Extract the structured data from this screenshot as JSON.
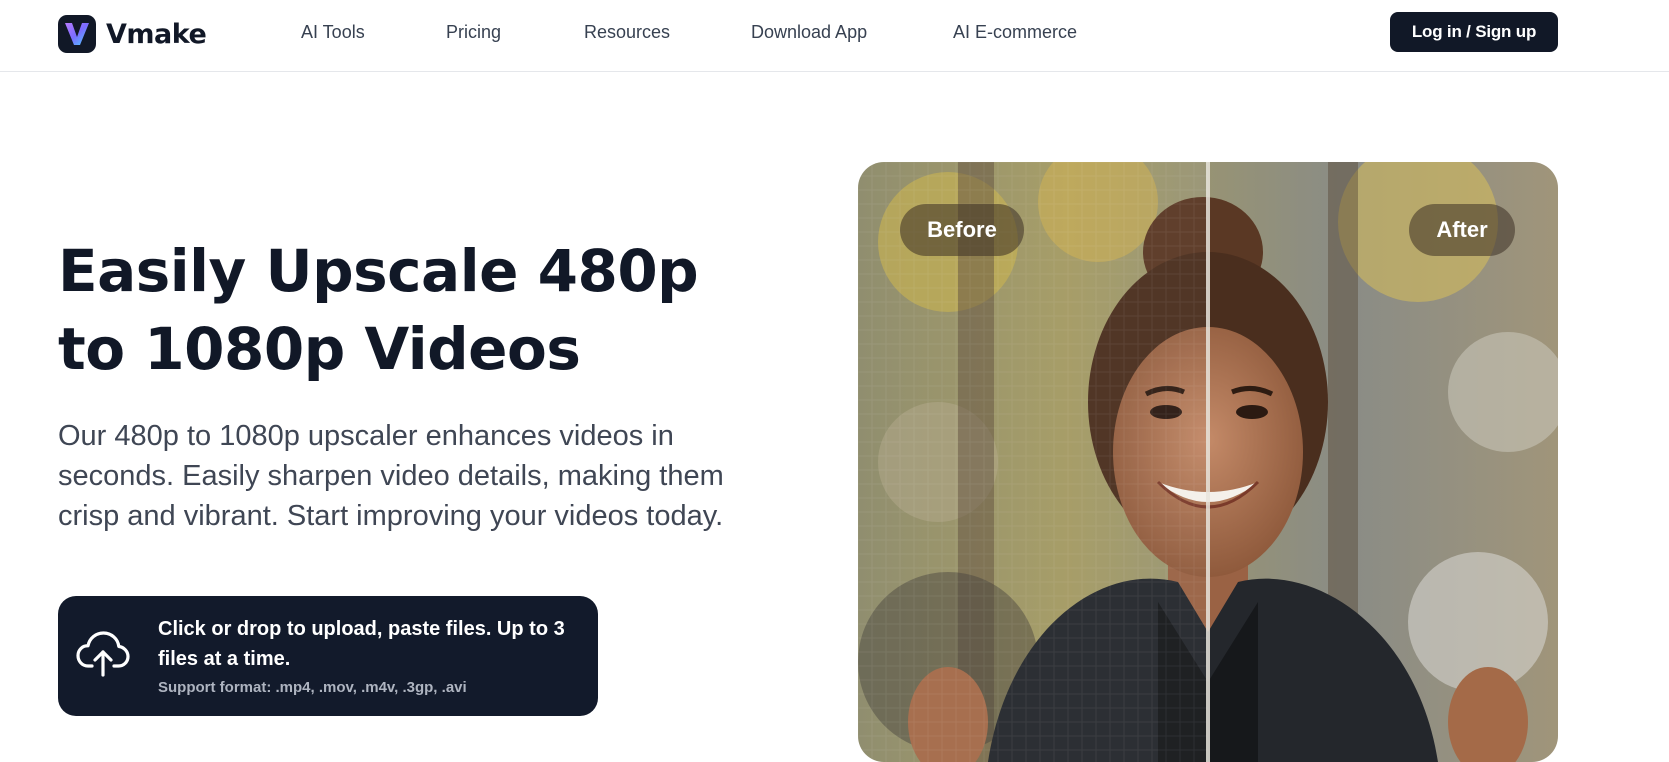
{
  "brand": {
    "name": "Vmake"
  },
  "nav": {
    "items": [
      {
        "label": "AI Tools"
      },
      {
        "label": "Pricing"
      },
      {
        "label": "Resources"
      },
      {
        "label": "Download App"
      },
      {
        "label": "AI E-commerce"
      }
    ],
    "login_label": "Log in / Sign up"
  },
  "hero": {
    "title": "Easily Upscale 480p to 1080p Videos",
    "description": "Our 480p to 1080p upscaler enhances videos in seconds. Easily sharpen video details, making them crisp and vibrant. Start improving your videos today."
  },
  "upload": {
    "main_text": "Click or drop to upload, paste files. Up to 3 files at a time.",
    "support_text": "Support format: .mp4, .mov, .m4v, .3gp, .avi",
    "icon": "cloud-upload-icon"
  },
  "comparison": {
    "before_label": "Before",
    "after_label": "After"
  },
  "colors": {
    "primary_dark": "#111827",
    "upload_bg": "#121a2b",
    "text_gray": "#374151",
    "border": "#e5e7eb"
  }
}
